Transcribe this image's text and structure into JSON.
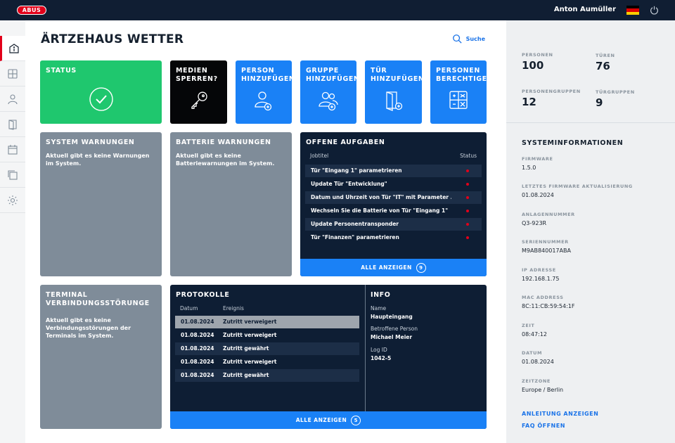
{
  "topbar": {
    "logo_text": "ABUS",
    "user_name": "Anton Aumüller",
    "flag_colors": [
      "#000000",
      "#dd0000",
      "#ffce00"
    ],
    "power_icon": "power-icon"
  },
  "sidebar": {
    "items": [
      {
        "name": "info",
        "icon": "info-icon",
        "active": true
      },
      {
        "name": "doors-overview",
        "icon": "grid-icon"
      },
      {
        "name": "persons",
        "icon": "person-icon"
      },
      {
        "name": "doors",
        "icon": "door-icon"
      },
      {
        "name": "calendar",
        "icon": "calendar-icon"
      },
      {
        "name": "copy",
        "icon": "copy-icon"
      },
      {
        "name": "settings",
        "icon": "gear-icon"
      }
    ]
  },
  "page": {
    "title": "ÄRTZEHAUS WETTER",
    "search_label": "Suche"
  },
  "tiles": {
    "status": "STATUS",
    "media_lock": "MEDIEN SPERREN?",
    "add_person": "PERSON HINZUFÜGEN",
    "add_group": "GRUPPE HINZUFÜGEN",
    "add_door": "TÜR HINZUFÜGEN",
    "person_perms": "PERSONEN BERECHTIGEN"
  },
  "system_warnings": {
    "title": "SYSTEM WARNUNGEN",
    "text": "Aktuell gibt es keine Warnungen im System."
  },
  "battery_warnings": {
    "title": "BATTERIE WARNUNGEN",
    "text": "Aktuell gibt es keine Batteriewarnungen im System."
  },
  "tasks": {
    "title": "OFFENE AUFGABEN",
    "col_job": "Jobtitel",
    "col_status": "Status",
    "rows": [
      "Tür \"Eingang 1\" parametrieren",
      "Update Tür \"Entwicklung\"",
      "Datum und Uhrzeit von Tür \"IT\" mit Parameter ...",
      "Wechseln Sie die Batterie von Tür \"Eingang 1\"",
      "Update Personentransponder",
      "Tür \"Finanzen\" parametrieren"
    ],
    "show_all": "ALLE ANZEIGEN",
    "count": "9"
  },
  "terminal": {
    "title": "TERMINAL VERBINDUNGSSTÖRUNGE",
    "text": "Aktuell gibt es keine Verbindungsstörungen der Terminals im System."
  },
  "protocols": {
    "title": "PROTOKOLLE",
    "col_date": "Datum",
    "col_event": "Ereignis",
    "rows": [
      {
        "date": "01.08.2024",
        "event": "Zutritt verweigert"
      },
      {
        "date": "01.08.2024",
        "event": "Zutritt verweigert"
      },
      {
        "date": "01.08.2024",
        "event": "Zutritt gewährt"
      },
      {
        "date": "01.08.2024",
        "event": "Zutritt verweigert"
      },
      {
        "date": "01.08.2024",
        "event": "Zutritt gewährt"
      }
    ],
    "show_all": "ALLE ANZEIGEN",
    "count": "5"
  },
  "info": {
    "title": "INFO",
    "name_label": "Name",
    "name_value": "Haupteingang",
    "person_label": "Betroffene Person",
    "person_value": "Michael Meier",
    "log_label": "Log ID",
    "log_value": "1042-5"
  },
  "stats": {
    "persons_label": "PERSONEN",
    "persons_value": "100",
    "doors_label": "TÜREN",
    "doors_value": "76",
    "groups_label": "PERSONENGRUPPEN",
    "groups_value": "12",
    "doorgroups_label": "TÜRGRUPPEN",
    "doorgroups_value": "9"
  },
  "sysinfo": {
    "title": "SYSTEMINFORMATIONEN",
    "items": [
      {
        "label": "FIRMWARE",
        "value": "1.5.0"
      },
      {
        "label": "LETZTES FIRMWARE AKTUALISIERUNG",
        "value": "01.08.2024"
      },
      {
        "label": "ANLAGENNUMMER",
        "value": "Q3-923R"
      },
      {
        "label": "SERIENNUMMER",
        "value": "M9AB840017ABA"
      },
      {
        "label": "IP ADRESSE",
        "value": "192.168.1.75"
      },
      {
        "label": "MAC ADDRESS",
        "value": "8C:11:CB:59:54:1F"
      },
      {
        "label": "ZEIT",
        "value": "08:47:12"
      },
      {
        "label": "DATUM",
        "value": "01.08.2024"
      },
      {
        "label": "ZEITZONE",
        "value": "Europe / Berlin"
      }
    ],
    "guide_link": "ANLEITUNG ANZEIGEN",
    "faq_link": "FAQ ÖFFNEN"
  },
  "colors": {
    "accent_blue": "#1a81f6",
    "status_green": "#1fc76e",
    "navy": "#0e1e34",
    "brand_red": "#e2001a"
  }
}
